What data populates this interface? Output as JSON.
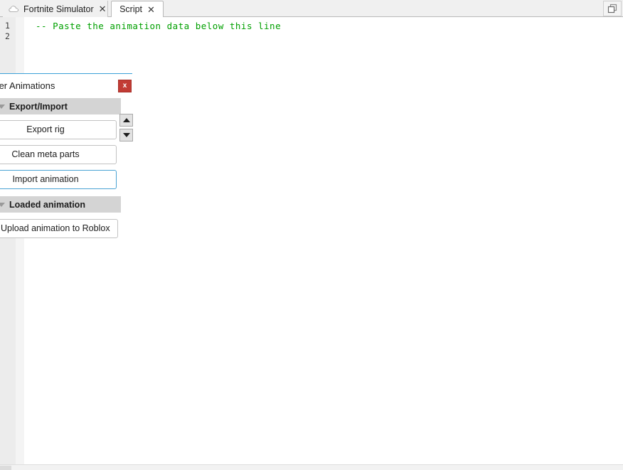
{
  "window": {
    "restore_button_icon": "restore-window-icon"
  },
  "tabs": [
    {
      "label": "Fortnite Simulator",
      "icon": "cloud-icon",
      "close_icon": "✕",
      "active": false
    },
    {
      "label": "Script",
      "icon": null,
      "close_icon": "✕",
      "active": true
    }
  ],
  "editor": {
    "line_numbers": [
      "1",
      "2"
    ],
    "lines": [
      {
        "text": "-- Paste the animation data below this line",
        "color": "#00a000"
      },
      {
        "text": ""
      }
    ],
    "comment_color": "#00a000"
  },
  "plugin_panel": {
    "title": "lender Animations",
    "close_label": "x",
    "close_color": "#c23b34",
    "accent_color": "#3ba0d8",
    "scroll_up_icon": "triangle-up-icon",
    "scroll_down_icon": "triangle-down-icon",
    "sections": [
      {
        "header": "Export/Import",
        "disclosure_icon": "chevron-down-icon",
        "buttons": [
          {
            "label": "Export rig",
            "focused": false
          },
          {
            "label": "Clean meta parts",
            "focused": false
          },
          {
            "label": "Import animation",
            "focused": true
          }
        ]
      },
      {
        "header": "Loaded animation",
        "disclosure_icon": "chevron-down-icon",
        "buttons": [
          {
            "label": "Upload animation to Roblox",
            "focused": false
          }
        ]
      }
    ]
  }
}
